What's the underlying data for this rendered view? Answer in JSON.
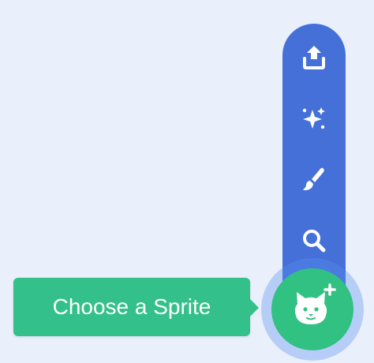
{
  "sprite_menu": {
    "tooltip": "Choose a Sprite",
    "items": [
      {
        "icon": "upload-icon"
      },
      {
        "icon": "surprise-icon"
      },
      {
        "icon": "paint-icon"
      },
      {
        "icon": "search-icon"
      }
    ],
    "main_icon": "cat-plus-icon"
  },
  "colors": {
    "background": "#e9f0fc",
    "menu_blue": "#4470d8",
    "action_green": "#31c183",
    "tooltip_green": "#33c08a"
  }
}
